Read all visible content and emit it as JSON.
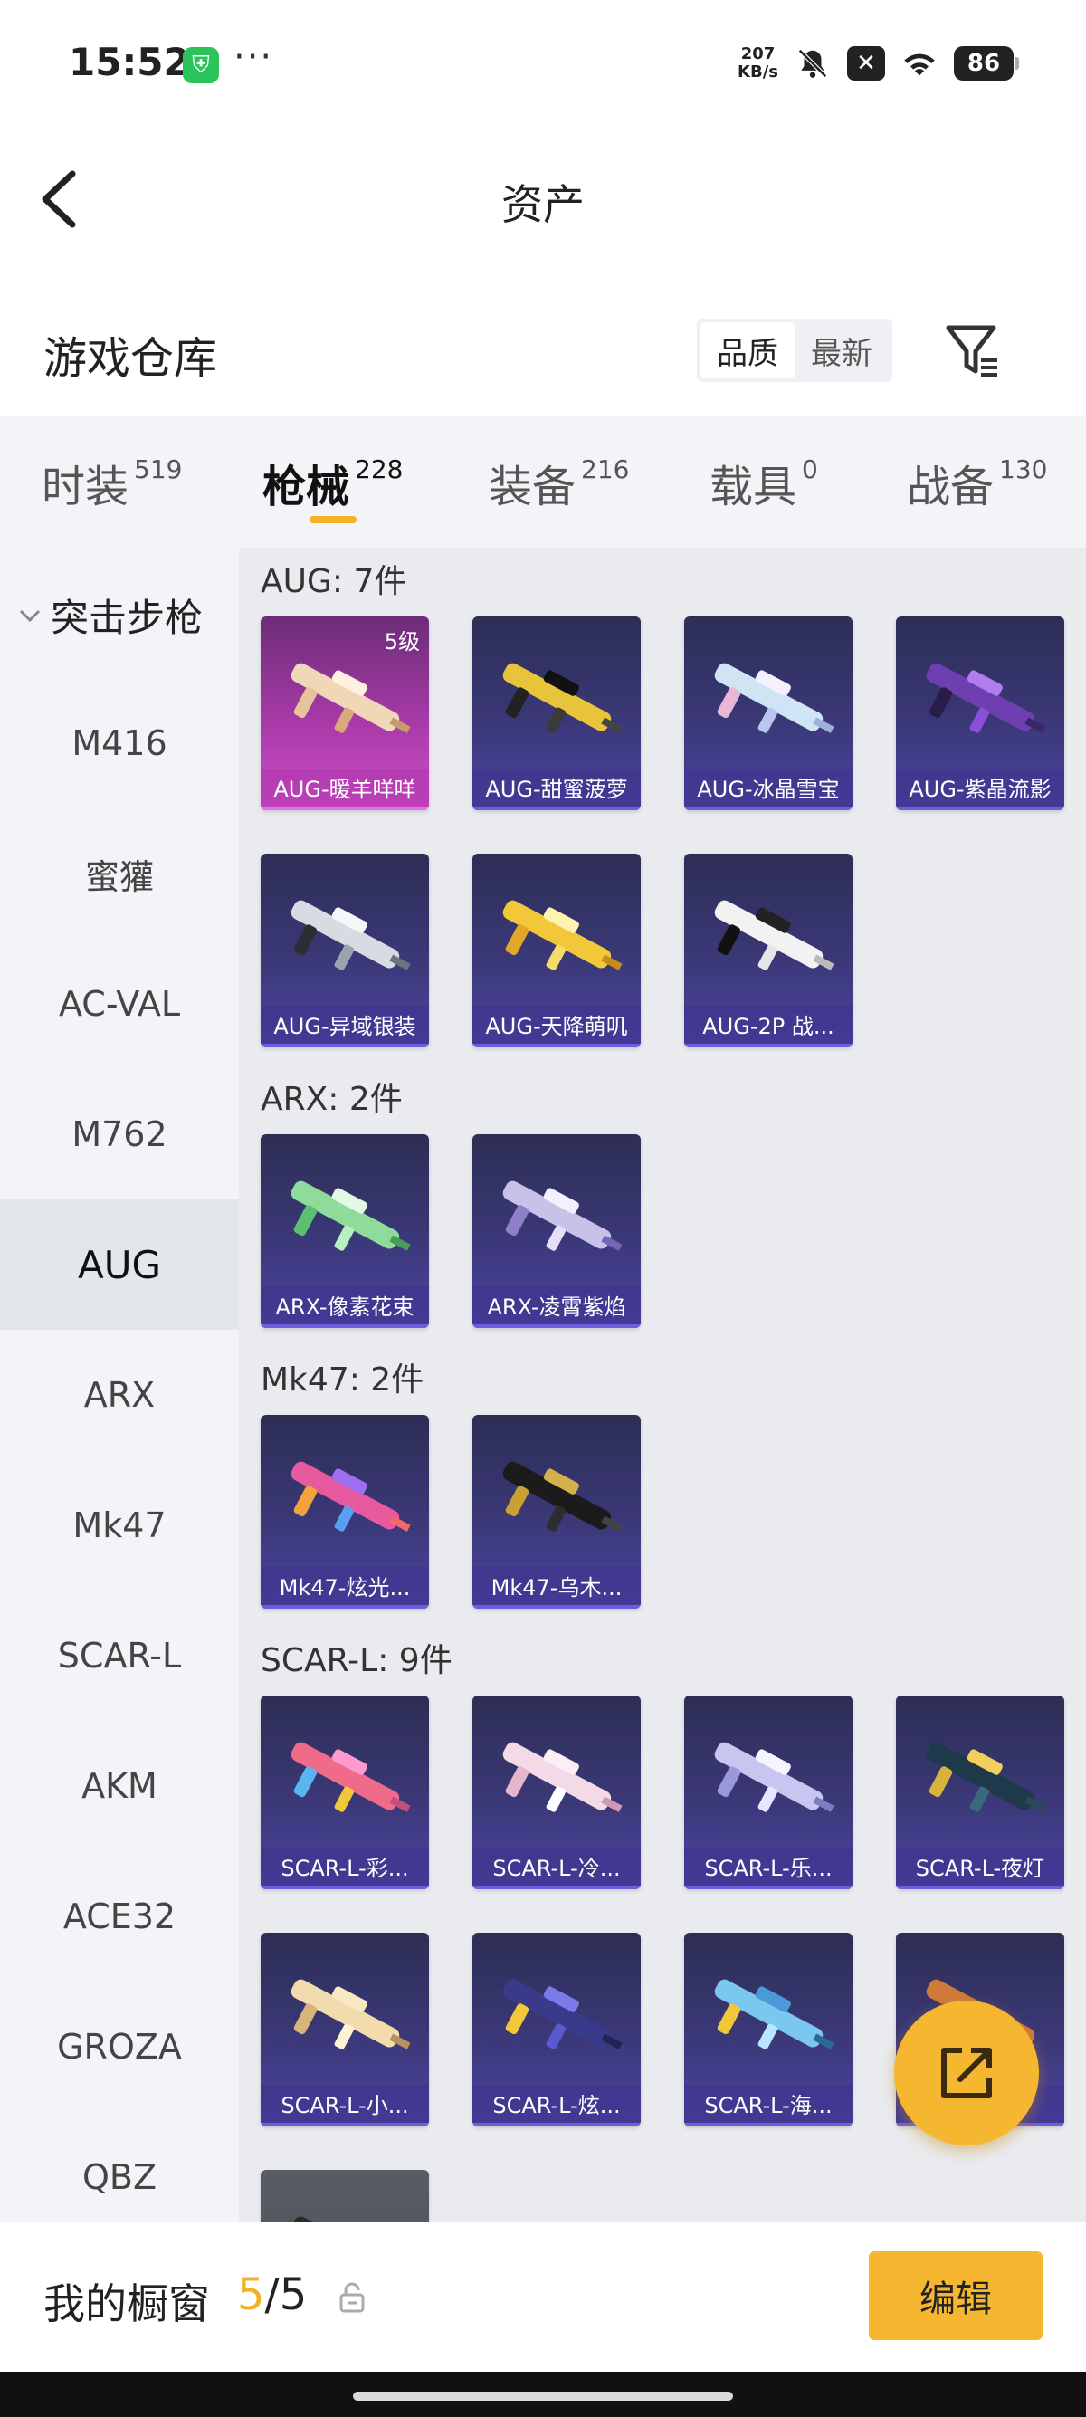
{
  "status_bar": {
    "time": "15:52",
    "net_speed_value": "207",
    "net_speed_unit": "KB/s",
    "battery": "86"
  },
  "header": {
    "title": "资产"
  },
  "warehouse": {
    "title": "游戏仓库",
    "sort": [
      "品质",
      "最新"
    ]
  },
  "tabs": [
    {
      "label": "时装",
      "count": "519"
    },
    {
      "label": "枪械",
      "count": "228"
    },
    {
      "label": "装备",
      "count": "216"
    },
    {
      "label": "载具",
      "count": "0"
    },
    {
      "label": "战备",
      "count": "130"
    }
  ],
  "sidebar": {
    "category": "突击步枪",
    "items": [
      "M416",
      "蜜獾",
      "AC-VAL",
      "M762",
      "AUG",
      "ARX",
      "Mk47",
      "SCAR-L",
      "AKM",
      "ACE32",
      "GROZA",
      "QBZ"
    ],
    "active": "AUG"
  },
  "sections": [
    {
      "title": "AUG: 7件",
      "items": [
        "AUG-暖羊咩咩",
        "AUG-甜蜜菠萝",
        "AUG-冰晶雪宝",
        "AUG-紫晶流影",
        "AUG-异域银装",
        "AUG-天降萌叽",
        "AUG-2P 战..."
      ],
      "first_level": "5级"
    },
    {
      "title": "ARX: 2件",
      "items": [
        "ARX-像素花束",
        "ARX-凌霄紫焰"
      ]
    },
    {
      "title": "Mk47: 2件",
      "items": [
        "Mk47-炫光...",
        "Mk47-乌木..."
      ]
    },
    {
      "title": "SCAR-L: 9件",
      "items": [
        "SCAR-L-彩...",
        "SCAR-L-冷...",
        "SCAR-L-乐...",
        "SCAR-L-夜灯",
        "SCAR-L-小...",
        "SCAR-L-炫...",
        "SCAR-L-海..."
      ]
    }
  ],
  "bottom": {
    "label": "我的橱窗",
    "current": "5",
    "total": "/5",
    "edit": "编辑"
  },
  "colors": {
    "accent": "#f5b730",
    "card_purple": "#3b3878",
    "card_pink": "#c44bc0"
  }
}
